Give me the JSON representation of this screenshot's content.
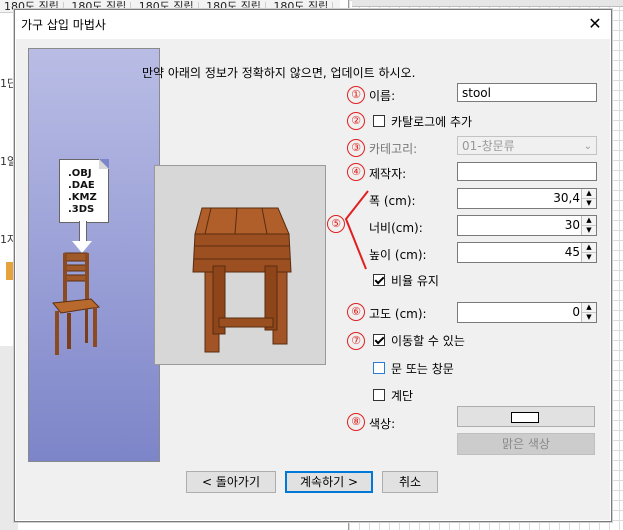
{
  "background": {
    "tabs": [
      "180도 직립",
      "180도 직립",
      "180도 직립",
      "180도 직립",
      "180도 직립"
    ],
    "left_labels": [
      "1단",
      "1열",
      "1자"
    ]
  },
  "dialog": {
    "title": "가구 삽입 마법사",
    "close_glyph": "✕",
    "info_text": "만약 아래의 정보가 정확하지 않으면, 업데이트 하시오.",
    "side_image": {
      "formats": [
        ".OBJ",
        ".DAE",
        ".KMZ",
        ".3DS"
      ],
      "icon": "import-chair-icon"
    }
  },
  "markers": [
    "①",
    "②",
    "③",
    "④",
    "⑤",
    "⑥",
    "⑦",
    "⑧"
  ],
  "form": {
    "name_label": "이름:",
    "name_value": "stool",
    "catalog_label": "카탈로그에 추가",
    "catalog_checked": false,
    "category_label": "카테고리:",
    "category_value": "01-창문류",
    "creator_label": "제작자:",
    "creator_value": "",
    "width_label": "폭 (cm):",
    "width_value": "30,4",
    "depth_label": "너비(cm):",
    "depth_value": "30",
    "height_label": "높이 (cm):",
    "height_value": "45",
    "keep_ratio_label": "비율 유지",
    "keep_ratio_checked": true,
    "elevation_label": "고도 (cm):",
    "elevation_value": "0",
    "movable_label": "이동할 수 있는",
    "movable_checked": true,
    "door_window_label": "문 또는 창문",
    "door_window_checked": false,
    "staircase_label": "계단",
    "staircase_checked": false,
    "color_label": "색상:",
    "light_color_label": "맑은 색상"
  },
  "buttons": {
    "back": "< 돌아가기",
    "next": "계속하기 >",
    "cancel": "취소"
  },
  "colors": {
    "accent": "#0078d7",
    "marker_red": "#e02020",
    "side_gradient_top": "#b9bde5",
    "side_gradient_bottom": "#7d85c9",
    "wood": "#a0522d"
  }
}
